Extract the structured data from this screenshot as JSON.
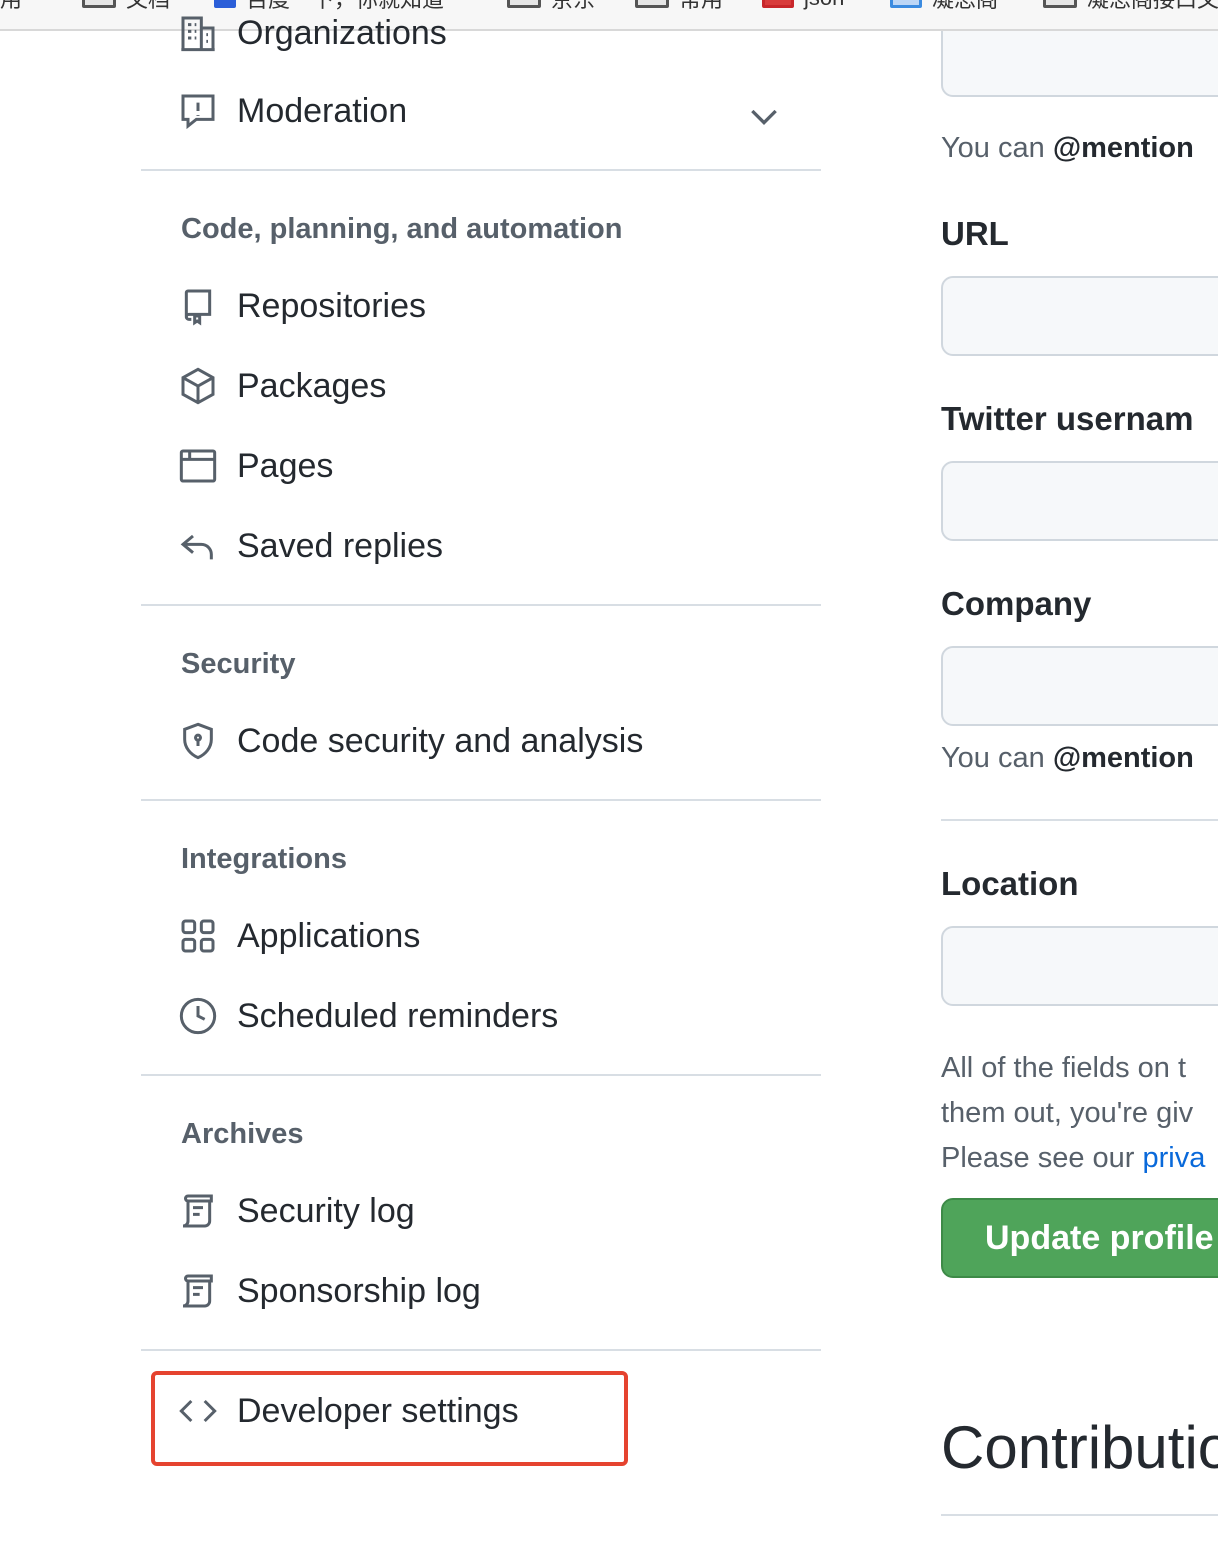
{
  "bookmarks": [
    {
      "label": "应用",
      "icon": "apps-icon"
    },
    {
      "label": "文档",
      "icon": "folder-icon"
    },
    {
      "label": "百度一下，你就知道",
      "icon": "baidu-icon"
    },
    {
      "label": "京东",
      "icon": "folder-icon"
    },
    {
      "label": "常用",
      "icon": "folder-icon"
    },
    {
      "label": "json",
      "icon": "json-icon"
    },
    {
      "label": "凝思阁",
      "icon": "translate-icon"
    },
    {
      "label": "凝思阁接口文档",
      "icon": "folder-icon"
    }
  ],
  "sidebar": {
    "top_items": [
      {
        "label": "Organizations",
        "icon": "organization-icon"
      },
      {
        "label": "Moderation",
        "icon": "report-icon",
        "expandable": true
      }
    ],
    "sections": [
      {
        "heading": "Code, planning, and automation",
        "items": [
          {
            "label": "Repositories",
            "icon": "repo-icon"
          },
          {
            "label": "Packages",
            "icon": "package-icon"
          },
          {
            "label": "Pages",
            "icon": "browser-icon"
          },
          {
            "label": "Saved replies",
            "icon": "reply-icon"
          }
        ]
      },
      {
        "heading": "Security",
        "items": [
          {
            "label": "Code security and analysis",
            "icon": "shield-lock-icon"
          }
        ]
      },
      {
        "heading": "Integrations",
        "items": [
          {
            "label": "Applications",
            "icon": "apps-grid-icon"
          },
          {
            "label": "Scheduled reminders",
            "icon": "clock-icon"
          }
        ]
      },
      {
        "heading": "Archives",
        "items": [
          {
            "label": "Security log",
            "icon": "log-icon"
          },
          {
            "label": "Sponsorship log",
            "icon": "log-icon"
          }
        ]
      }
    ],
    "developer_settings": {
      "label": "Developer settings",
      "icon": "code-icon"
    },
    "highlight_color": "#e5432f"
  },
  "form": {
    "bio_note_prefix": "You can ",
    "bio_note_mention": "@mention",
    "url_label": "URL",
    "twitter_label": "Twitter usernam",
    "company_label": "Company",
    "company_note_prefix": "You can ",
    "company_note_mention": "@mention",
    "location_label": "Location",
    "privacy_line1": "All of the fields on t",
    "privacy_line2": "them out, you're giv",
    "privacy_line3_prefix": "Please see our ",
    "privacy_link": "priva",
    "update_button": "Update profile",
    "contributions_heading": "Contributio",
    "button_color": "#4fa45a",
    "link_color": "#0969da"
  }
}
